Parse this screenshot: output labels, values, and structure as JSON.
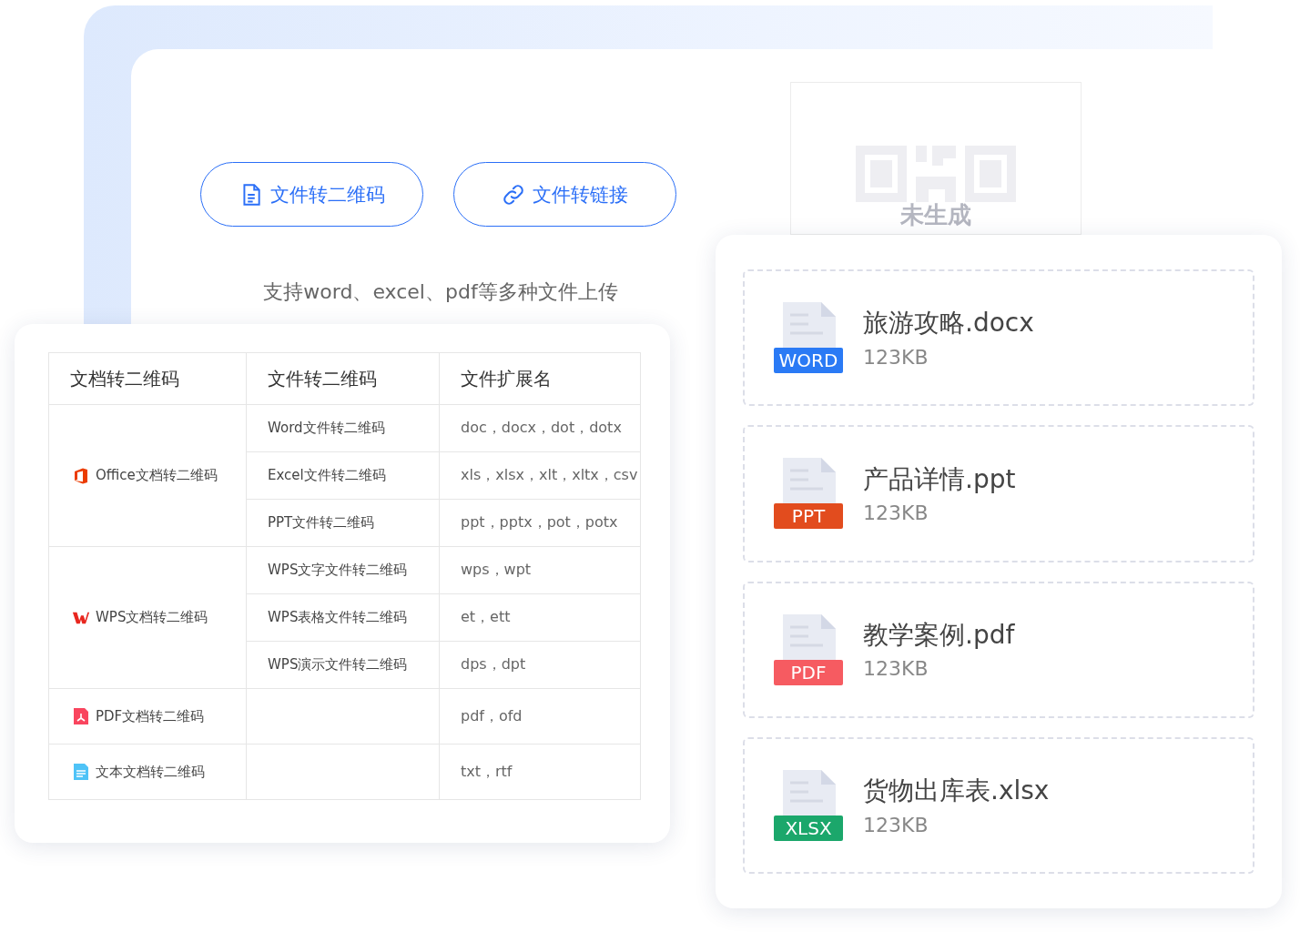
{
  "upload_panel": {
    "buttons": [
      {
        "label": "文件转二维码",
        "kind": "document"
      },
      {
        "label": "文件转链接",
        "kind": "link"
      }
    ],
    "hint": "支持word、excel、pdf等多种文件上传",
    "qr_placeholder": {
      "label": "未生成"
    }
  },
  "format_table": {
    "columns": [
      "文档转二维码",
      "文件转二维码",
      "文件扩展名"
    ],
    "groups": [
      {
        "label": "Office文档转二维码",
        "kind": "office",
        "rows": [
          {
            "type": "Word文件转二维码",
            "extensions": "doc，docx，dot，dotx"
          },
          {
            "type": "Excel文件转二维码",
            "extensions": "xls，xlsx，xlt，xltx，csv"
          },
          {
            "type": "PPT文件转二维码",
            "extensions": "ppt，pptx，pot，potx"
          }
        ]
      },
      {
        "label": "WPS文档转二维码",
        "kind": "wps",
        "rows": [
          {
            "type": "WPS文字文件转二维码",
            "extensions": "wps，wpt"
          },
          {
            "type": "WPS表格文件转二维码",
            "extensions": "et，ett"
          },
          {
            "type": "WPS演示文件转二维码",
            "extensions": "dps，dpt"
          }
        ]
      },
      {
        "label": "PDF文档转二维码",
        "kind": "pdf",
        "rows": [
          {
            "extensions": "pdf，ofd"
          }
        ]
      },
      {
        "label": "文本文档转二维码",
        "kind": "text",
        "rows": [
          {
            "extensions": "txt，rtf"
          }
        ]
      }
    ]
  },
  "files": [
    {
      "name": "旅游攻略.docx",
      "size": "123KB",
      "badge": "WORD",
      "color": "#2a7af5"
    },
    {
      "name": "产品详情.ppt",
      "size": "123KB",
      "badge": "PPT",
      "color": "#e24c1e"
    },
    {
      "name": "教学案例.pdf",
      "size": "123KB",
      "badge": "PDF",
      "color": "#f65b61"
    },
    {
      "name": "货物出库表.xlsx",
      "size": "123KB",
      "badge": "XLSX",
      "color": "#1ba76b"
    }
  ]
}
